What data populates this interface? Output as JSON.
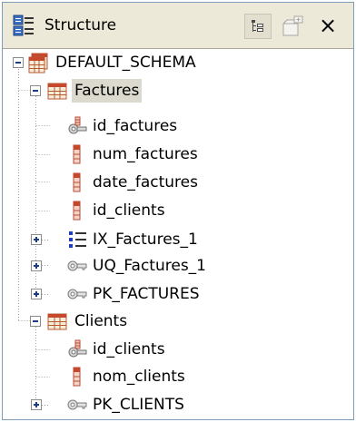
{
  "view": {
    "title": "Structure",
    "icons": [
      "structure-view-icon",
      "hierarchy-toggle-icon",
      "new-window-icon",
      "close-icon"
    ],
    "close_glyph": "×"
  },
  "tree": {
    "schema": {
      "label": "DEFAULT_SCHEMA",
      "icon": "database-schema-icon",
      "expanded": true
    },
    "tables": [
      {
        "label": "Factures",
        "icon": "table-icon",
        "expanded": true,
        "selected": true,
        "children": [
          {
            "label": "id_factures",
            "icon": "primary-key-column-icon",
            "expandable": false
          },
          {
            "label": "num_factures",
            "icon": "column-icon",
            "expandable": false
          },
          {
            "label": "date_factures",
            "icon": "column-icon",
            "expandable": false
          },
          {
            "label": "id_clients",
            "icon": "column-icon",
            "expandable": false
          },
          {
            "label": "IX_Factures_1",
            "icon": "index-icon",
            "expandable": true
          },
          {
            "label": "UQ_Factures_1",
            "icon": "key-constraint-icon",
            "expandable": true
          },
          {
            "label": "PK_FACTURES",
            "icon": "key-constraint-icon",
            "expandable": true
          }
        ]
      },
      {
        "label": "Clients",
        "icon": "table-icon",
        "expanded": true,
        "selected": false,
        "children": [
          {
            "label": "id_clients",
            "icon": "primary-key-column-icon",
            "expandable": false
          },
          {
            "label": "nom_clients",
            "icon": "column-icon",
            "expandable": false
          },
          {
            "label": "PK_CLIENTS",
            "icon": "key-constraint-icon",
            "expandable": true
          }
        ]
      }
    ]
  }
}
